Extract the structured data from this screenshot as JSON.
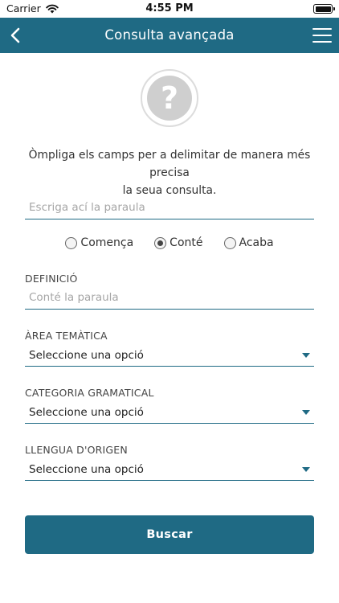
{
  "status_bar": {
    "carrier": "Carrier",
    "time": "4:55 PM"
  },
  "nav": {
    "title": "Consulta avançada",
    "back_icon": "chevron-left-icon",
    "menu_icon": "hamburger-menu-icon"
  },
  "help_icon": {
    "glyph": "?"
  },
  "intro": {
    "line1": "Òmpliga els camps per a delimitar de manera més precisa",
    "line2": "la seua consulta."
  },
  "search_word": {
    "placeholder": "Escriga ací la paraula"
  },
  "match_options": [
    {
      "label": "Comença",
      "checked": false
    },
    {
      "label": "Conté",
      "checked": true
    },
    {
      "label": "Acaba",
      "checked": false
    }
  ],
  "definition": {
    "label": "DEFINICIÓ",
    "placeholder": "Conté la paraula"
  },
  "thematic_area": {
    "label": "ÀREA TEMÀTICA",
    "value": "Seleccione una opció"
  },
  "grammar_category": {
    "label": "CATEGORIA GRAMATICAL",
    "value": "Seleccione una opció"
  },
  "origin_language": {
    "label": "LLENGUA D'ORIGEN",
    "value": "Seleccione una opció"
  },
  "search_button": {
    "label": "Buscar"
  },
  "colors": {
    "accent": "#1f6a84",
    "placeholder": "#a6a6a6"
  }
}
